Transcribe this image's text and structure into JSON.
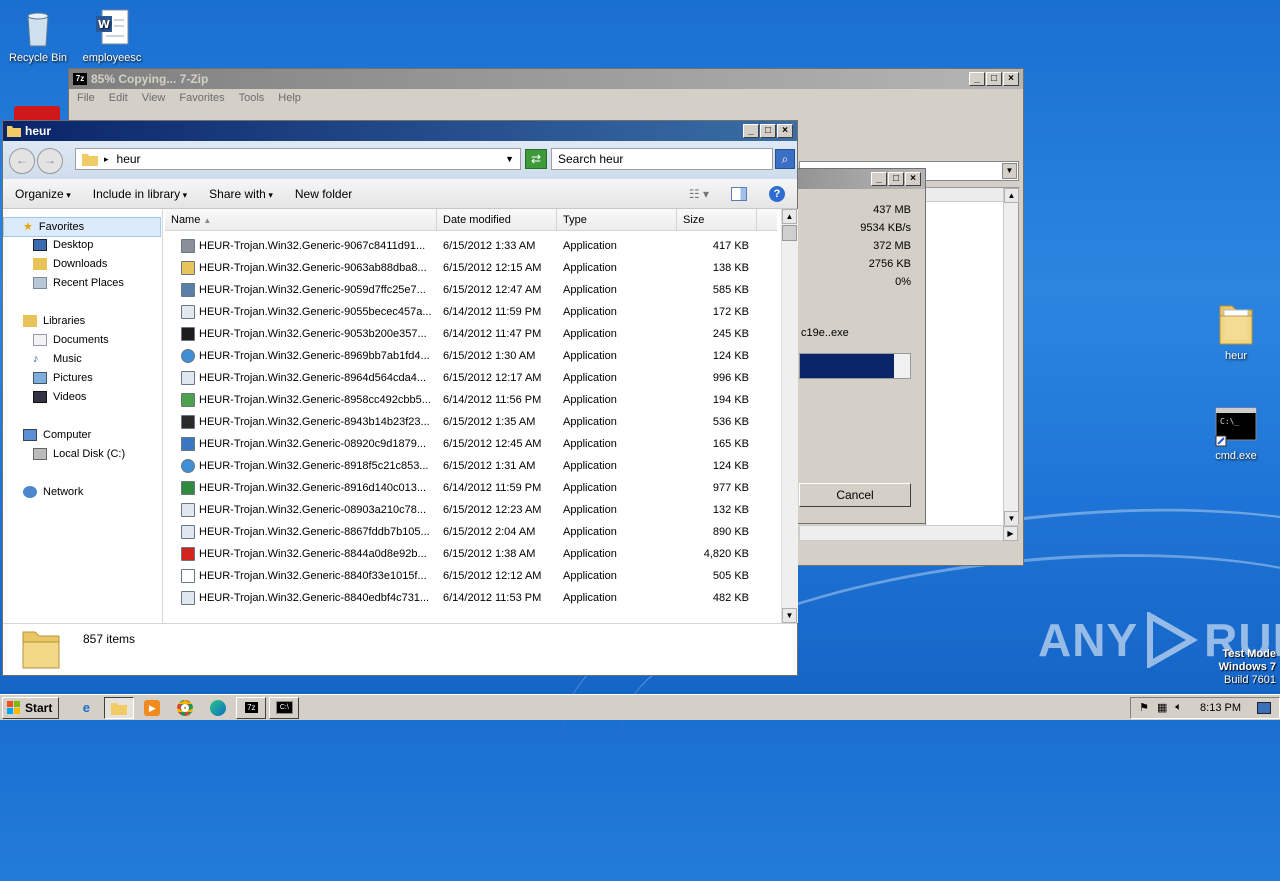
{
  "desktop": {
    "icons": [
      {
        "label": "Recycle Bin",
        "icon": "recycle-bin-icon"
      },
      {
        "label": "employeesc",
        "icon": "word-document-icon"
      },
      {
        "label": "heur",
        "icon": "folder-icon"
      },
      {
        "label": "cmd.exe",
        "icon": "cmd-icon"
      }
    ],
    "watermark": {
      "brand_left": "ANY",
      "brand_right": "RUN",
      "line1": "Test Mode",
      "line2": "Windows 7",
      "line3": "Build 7601"
    }
  },
  "zip_window": {
    "title": "85% Copying... 7-Zip",
    "menu": [
      "File",
      "Edit",
      "View",
      "Favorites",
      "Tools",
      "Help"
    ]
  },
  "progress_dialog": {
    "values": [
      "437 MB",
      "9534 KB/s",
      "372 MB",
      "2756 KB",
      "0%"
    ],
    "filename": "c19e..exe",
    "progress_percent": 85,
    "cancel_label": "Cancel"
  },
  "explorer": {
    "title": "heur",
    "address": "heur",
    "search_placeholder": "Search heur",
    "toolbar": {
      "organize": "Organize",
      "include_in_library": "Include in library",
      "share_with": "Share with",
      "new_folder": "New folder"
    },
    "nav": {
      "favorites": "Favorites",
      "desktop": "Desktop",
      "downloads": "Downloads",
      "recent_places": "Recent Places",
      "libraries": "Libraries",
      "documents": "Documents",
      "music": "Music",
      "pictures": "Pictures",
      "videos": "Videos",
      "computer": "Computer",
      "local_disk": "Local Disk (C:)",
      "network": "Network"
    },
    "columns": {
      "name": "Name",
      "date": "Date modified",
      "type": "Type",
      "size": "Size"
    },
    "files": [
      {
        "name": "HEUR-Trojan.Win32.Generic-9067c8411d91...",
        "date": "6/15/2012 1:33 AM",
        "type": "Application",
        "size": "417 KB",
        "icon": "setup-app-icon"
      },
      {
        "name": "HEUR-Trojan.Win32.Generic-9063ab88dba8...",
        "date": "6/15/2012 12:15 AM",
        "type": "Application",
        "size": "138 KB",
        "icon": "folder-app-icon"
      },
      {
        "name": "HEUR-Trojan.Win32.Generic-9059d7ffc25e7...",
        "date": "6/15/2012 12:47 AM",
        "type": "Application",
        "size": "585 KB",
        "icon": "tool-app-icon"
      },
      {
        "name": "HEUR-Trojan.Win32.Generic-9055becec457a...",
        "date": "6/14/2012 11:59 PM",
        "type": "Application",
        "size": "172 KB",
        "icon": "generic-app-icon"
      },
      {
        "name": "HEUR-Trojan.Win32.Generic-9053b200e357...",
        "date": "6/14/2012 11:47 PM",
        "type": "Application",
        "size": "245 KB",
        "icon": "chart-app-icon"
      },
      {
        "name": "HEUR-Trojan.Win32.Generic-8969bb7ab1fd4...",
        "date": "6/15/2012 1:30 AM",
        "type": "Application",
        "size": "124 KB",
        "icon": "globe-app-icon"
      },
      {
        "name": "HEUR-Trojan.Win32.Generic-8964d564cda4...",
        "date": "6/15/2012 12:17 AM",
        "type": "Application",
        "size": "996 KB",
        "icon": "generic-app-icon"
      },
      {
        "name": "HEUR-Trojan.Win32.Generic-8958cc492cbb5...",
        "date": "6/14/2012 11:56 PM",
        "type": "Application",
        "size": "194 KB",
        "icon": "colorful-app-icon"
      },
      {
        "name": "HEUR-Trojan.Win32.Generic-8943b14b23f23...",
        "date": "6/15/2012 1:35 AM",
        "type": "Application",
        "size": "536 KB",
        "icon": "dvd-app-icon"
      },
      {
        "name": "HEUR-Trojan.Win32.Generic-08920c9d1879...",
        "date": "6/15/2012 12:45 AM",
        "type": "Application",
        "size": "165 KB",
        "icon": "installer-app-icon"
      },
      {
        "name": "HEUR-Trojan.Win32.Generic-8918f5c21c853...",
        "date": "6/15/2012 1:31 AM",
        "type": "Application",
        "size": "124 KB",
        "icon": "globe-app-icon"
      },
      {
        "name": "HEUR-Trojan.Win32.Generic-8916d140c013...",
        "date": "6/14/2012 11:59 PM",
        "type": "Application",
        "size": "977 KB",
        "icon": "green-app-icon"
      },
      {
        "name": "HEUR-Trojan.Win32.Generic-08903a210c78...",
        "date": "6/15/2012 12:23 AM",
        "type": "Application",
        "size": "132 KB",
        "icon": "generic-app-icon"
      },
      {
        "name": "HEUR-Trojan.Win32.Generic-8867fddb7b105...",
        "date": "6/15/2012 2:04 AM",
        "type": "Application",
        "size": "890 KB",
        "icon": "generic-app-icon"
      },
      {
        "name": "HEUR-Trojan.Win32.Generic-8844a0d8e92b...",
        "date": "6/15/2012 1:38 AM",
        "type": "Application",
        "size": "4,820 KB",
        "icon": "red-app-icon"
      },
      {
        "name": "HEUR-Trojan.Win32.Generic-8840f33e1015f...",
        "date": "6/15/2012 12:12 AM",
        "type": "Application",
        "size": "505 KB",
        "icon": "window-app-icon"
      },
      {
        "name": "HEUR-Trojan.Win32.Generic-8840edbf4c731...",
        "date": "6/14/2012 11:53 PM",
        "type": "Application",
        "size": "482 KB",
        "icon": "generic-app-icon"
      }
    ],
    "status": "857 items"
  },
  "taskbar": {
    "start_label": "Start",
    "clock": "8:13 PM"
  }
}
